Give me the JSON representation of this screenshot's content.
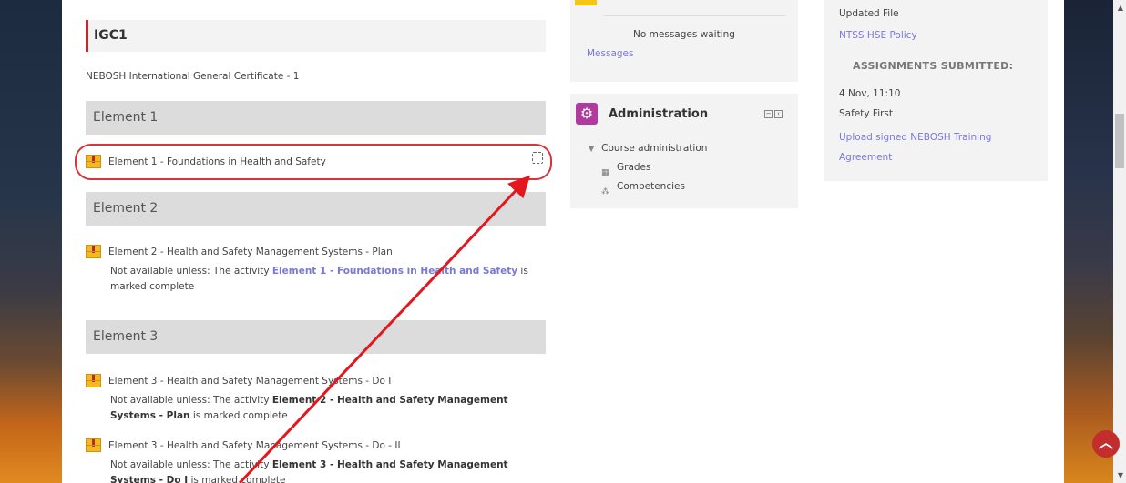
{
  "course": {
    "title": "IGC1",
    "description": "NEBOSH International General Certificate - 1"
  },
  "sections": [
    {
      "header": "Element 1"
    },
    {
      "header": "Element 2"
    },
    {
      "header": "Element 3"
    }
  ],
  "activities": {
    "e1": {
      "title": "Element 1 - Foundations in Health and Safety"
    },
    "e2": {
      "title": "Element 2 - Health and Safety Management Systems - Plan",
      "restriction_prefix": "Not available unless: The activity ",
      "restriction_link": "Element 1 - Foundations in Health and Safety",
      "restriction_suffix": " is marked complete"
    },
    "e3a": {
      "title": "Element 3 - Health and Safety Management Systems - Do I",
      "restriction_prefix": "Not available unless: The activity ",
      "restriction_bold": "Element 2 - Health and Safety Management Systems - Plan",
      "restriction_suffix": " is marked complete"
    },
    "e3b": {
      "title": "Element 3 - Health and Safety Management Systems - Do - II",
      "restriction_prefix": "Not available unless: The activity ",
      "restriction_bold": "Element 3 - Health and Safety Management Systems - Do I",
      "restriction_suffix": " is marked complete"
    }
  },
  "messages_block": {
    "no_messages": "No messages waiting",
    "link": "Messages"
  },
  "admin_block": {
    "title": "Administration",
    "course_admin": "Course administration",
    "grades": "Grades",
    "competencies": "Competencies"
  },
  "recent_block": {
    "updated_file": "Updated File",
    "file_link": "NTSS HSE Policy",
    "assignments_header": "ASSIGNMENTS SUBMITTED:",
    "date": "4 Nov, 11:10",
    "assignment_name": "Safety First",
    "assignment_link": "Upload signed NEBOSH Training Agreement"
  },
  "icons": {
    "activity": "package-icon",
    "admin": "gears-icon",
    "grades": "table-icon",
    "competencies": "competencies-icon",
    "back_to_top": "chevron-up-icon"
  },
  "colors": {
    "accent": "#c0282d",
    "link": "#7a78d9",
    "admin_icon": "#b13a9f",
    "annotation": "#e3171d"
  }
}
